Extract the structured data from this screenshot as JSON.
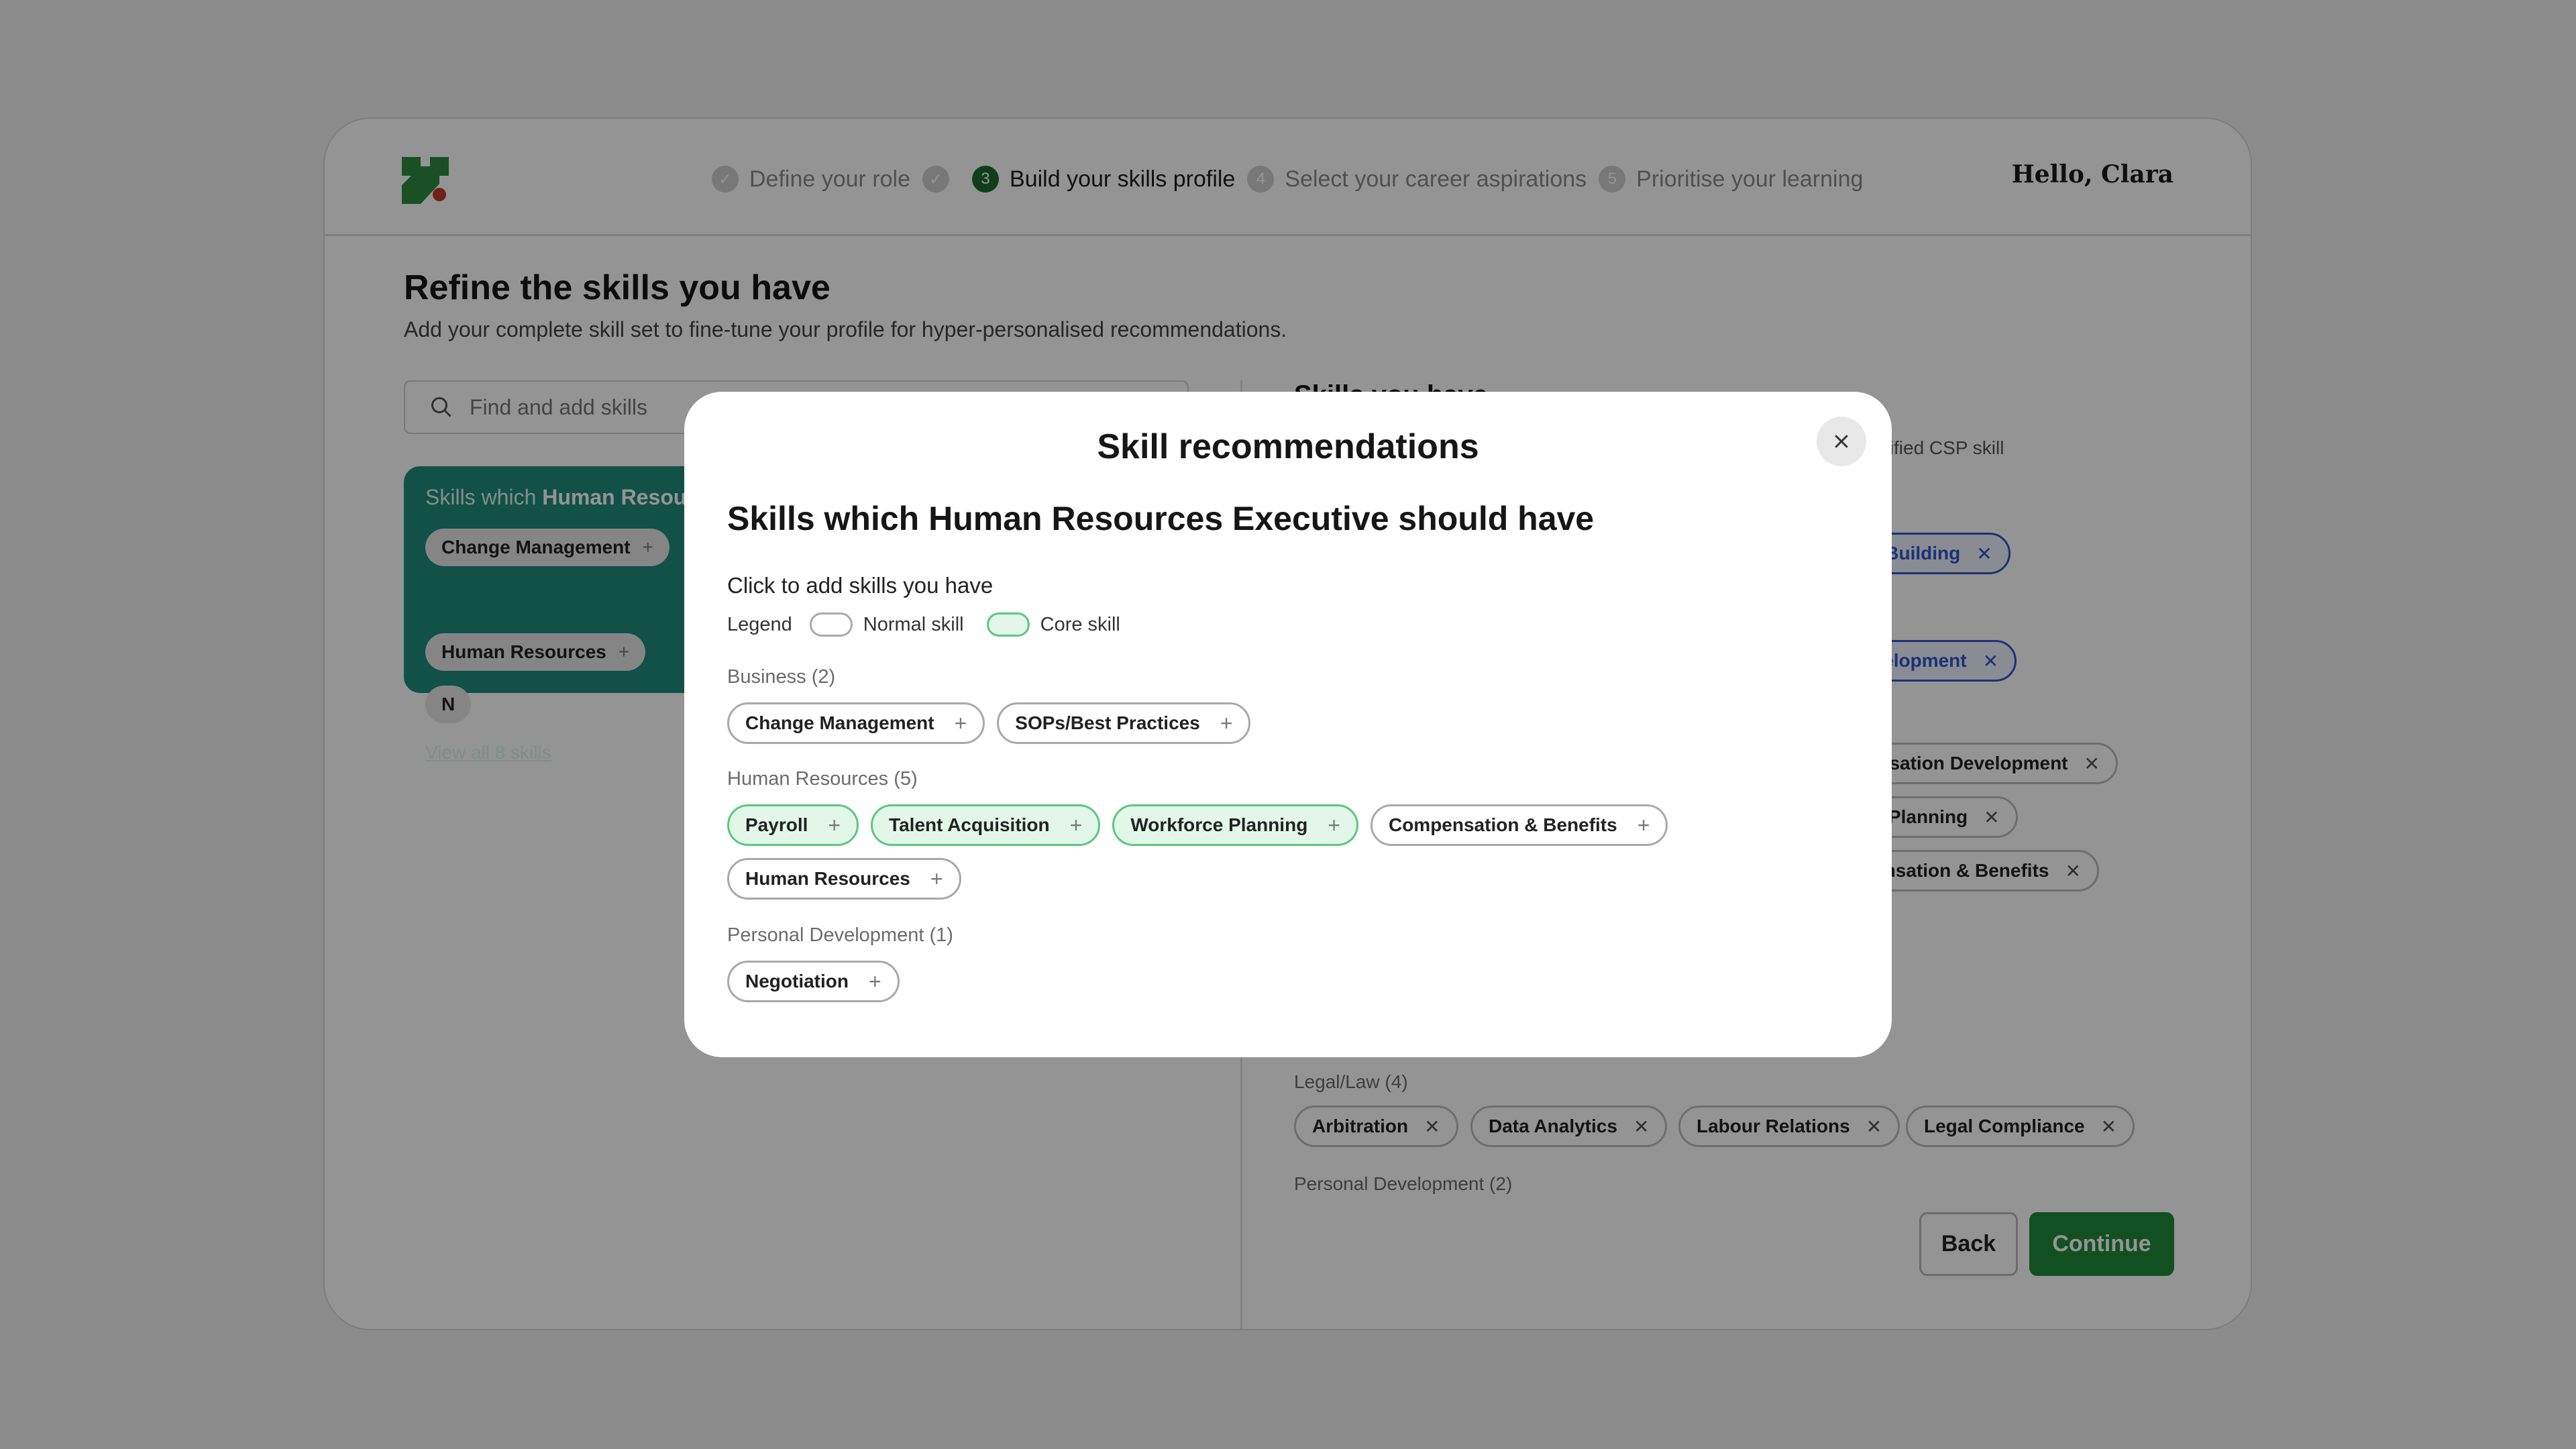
{
  "header": {
    "steps": [
      {
        "label": "Define your role",
        "state": "done",
        "icon": "check-icon"
      },
      {
        "label": "",
        "state": "done",
        "icon": "check-icon"
      },
      {
        "label": "Build your skills profile",
        "number": "3",
        "state": "active"
      },
      {
        "label": "Select your career aspirations",
        "number": "4",
        "state": "pending"
      },
      {
        "label": "Prioritise your learning",
        "number": "5",
        "state": "pending"
      }
    ],
    "greeting": "Hello, Clara"
  },
  "page": {
    "title": "Refine the skills you have",
    "subtitle": "Add your complete skill set to fine-tune your profile for hyper-personalised recommendations.",
    "search_placeholder": "Find and add skills"
  },
  "rec_panel": {
    "title_prefix": "Skills which",
    "title_bold": "Human Resourc",
    "chips": [
      "Change Management",
      "Human Resources",
      "N"
    ],
    "view_all": "View all 8 skills"
  },
  "right_col": {
    "title": "Skills you have",
    "note": "tified CSP skill",
    "chips_blue": [
      "re Building",
      "evelopment"
    ],
    "chips_partial": [
      "anisation Development",
      "ce Planning",
      "pensation & Benefits"
    ],
    "legal_group": "Legal/Law (4)",
    "legal_chips": [
      "Arbitration",
      "Data Analytics",
      "Labour Relations",
      "Legal Compliance"
    ],
    "personal_group": "Personal Development (2)"
  },
  "footer": {
    "back": "Back",
    "continue": "Continue"
  },
  "modal": {
    "title": "Skill recommendations",
    "heading": "Skills which Human Resources Executive should have",
    "instruction": "Click to add skills you have",
    "legend": {
      "label": "Legend",
      "normal": "Normal skill",
      "core": "Core skill"
    },
    "groups": [
      {
        "label": "Business (2)",
        "chips": [
          "Change Management",
          "SOPs/Best Practices"
        ]
      },
      {
        "label": "Human Resources (5)",
        "chips": [
          "Payroll",
          "Talent Acquisition",
          "Workforce Planning",
          "Compensation & Benefits",
          "Human Resources"
        ],
        "core": [
          true,
          true,
          true,
          false,
          false
        ]
      },
      {
        "label": "Personal Development (1)",
        "chips": [
          "Negotiation"
        ]
      }
    ],
    "plus": "+"
  },
  "colors": {
    "brand_green": "#1f8a3a",
    "teal_panel": "#1e8c7a",
    "core_border": "#5cc77f",
    "core_fill": "#e2f7e8",
    "blue_chip": "#2f57c9"
  }
}
